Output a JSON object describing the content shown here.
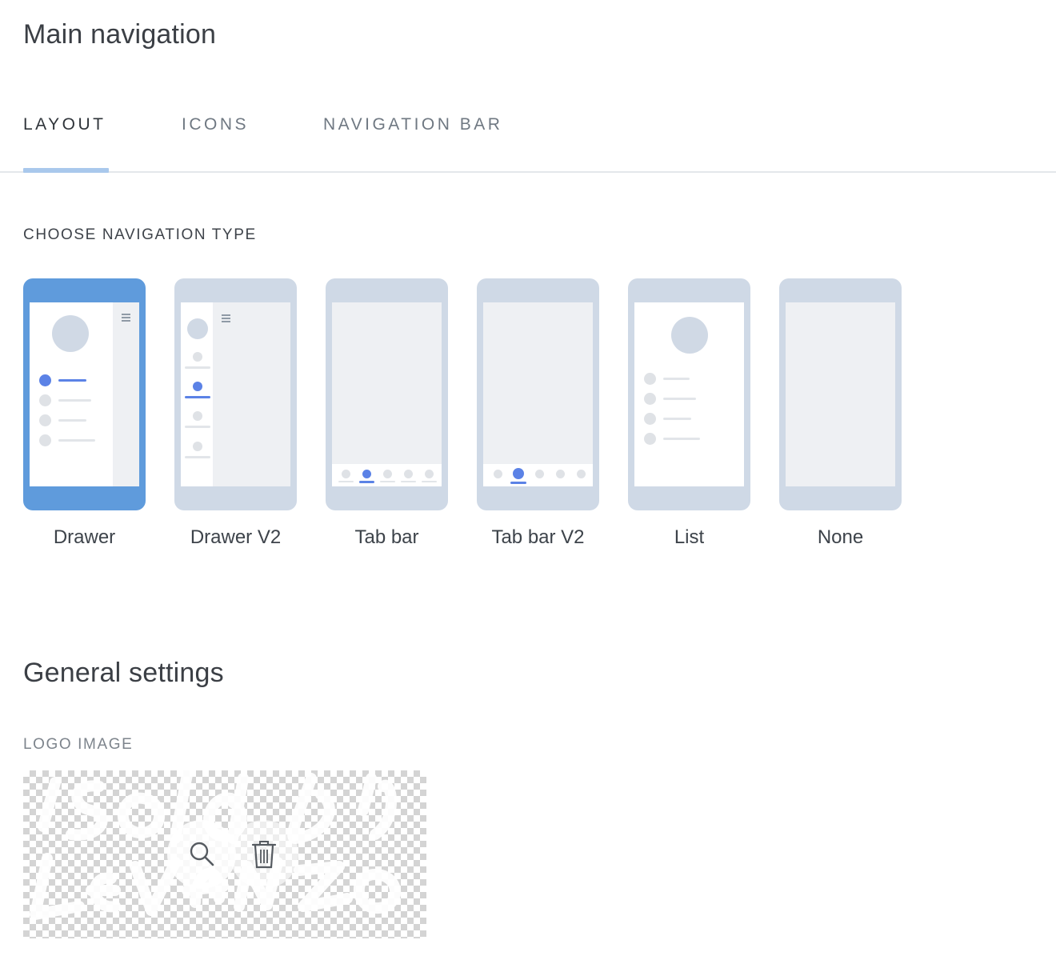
{
  "header": {
    "title": "Main navigation"
  },
  "tabs": [
    {
      "label": "LAYOUT",
      "active": true
    },
    {
      "label": "ICONS",
      "active": false
    },
    {
      "label": "NAVIGATION BAR",
      "active": false
    }
  ],
  "navigation_type": {
    "heading": "CHOOSE NAVIGATION TYPE",
    "selected": "Drawer",
    "options": [
      {
        "label": "Drawer"
      },
      {
        "label": "Drawer V2"
      },
      {
        "label": "Tab bar"
      },
      {
        "label": "Tab bar V2"
      },
      {
        "label": "List"
      },
      {
        "label": "None"
      }
    ]
  },
  "general_settings": {
    "title": "General settings",
    "logo_image_label": "LOGO IMAGE",
    "logo_text": "Isola di Levanzo",
    "actions": {
      "zoom_icon": "search-icon",
      "delete_icon": "trash-icon"
    }
  },
  "colors": {
    "accent": "#5f9bdc",
    "tab_indicator": "#a9c8ec",
    "phone_default": "#cfd9e6",
    "highlight_dot": "#5b82e6"
  }
}
